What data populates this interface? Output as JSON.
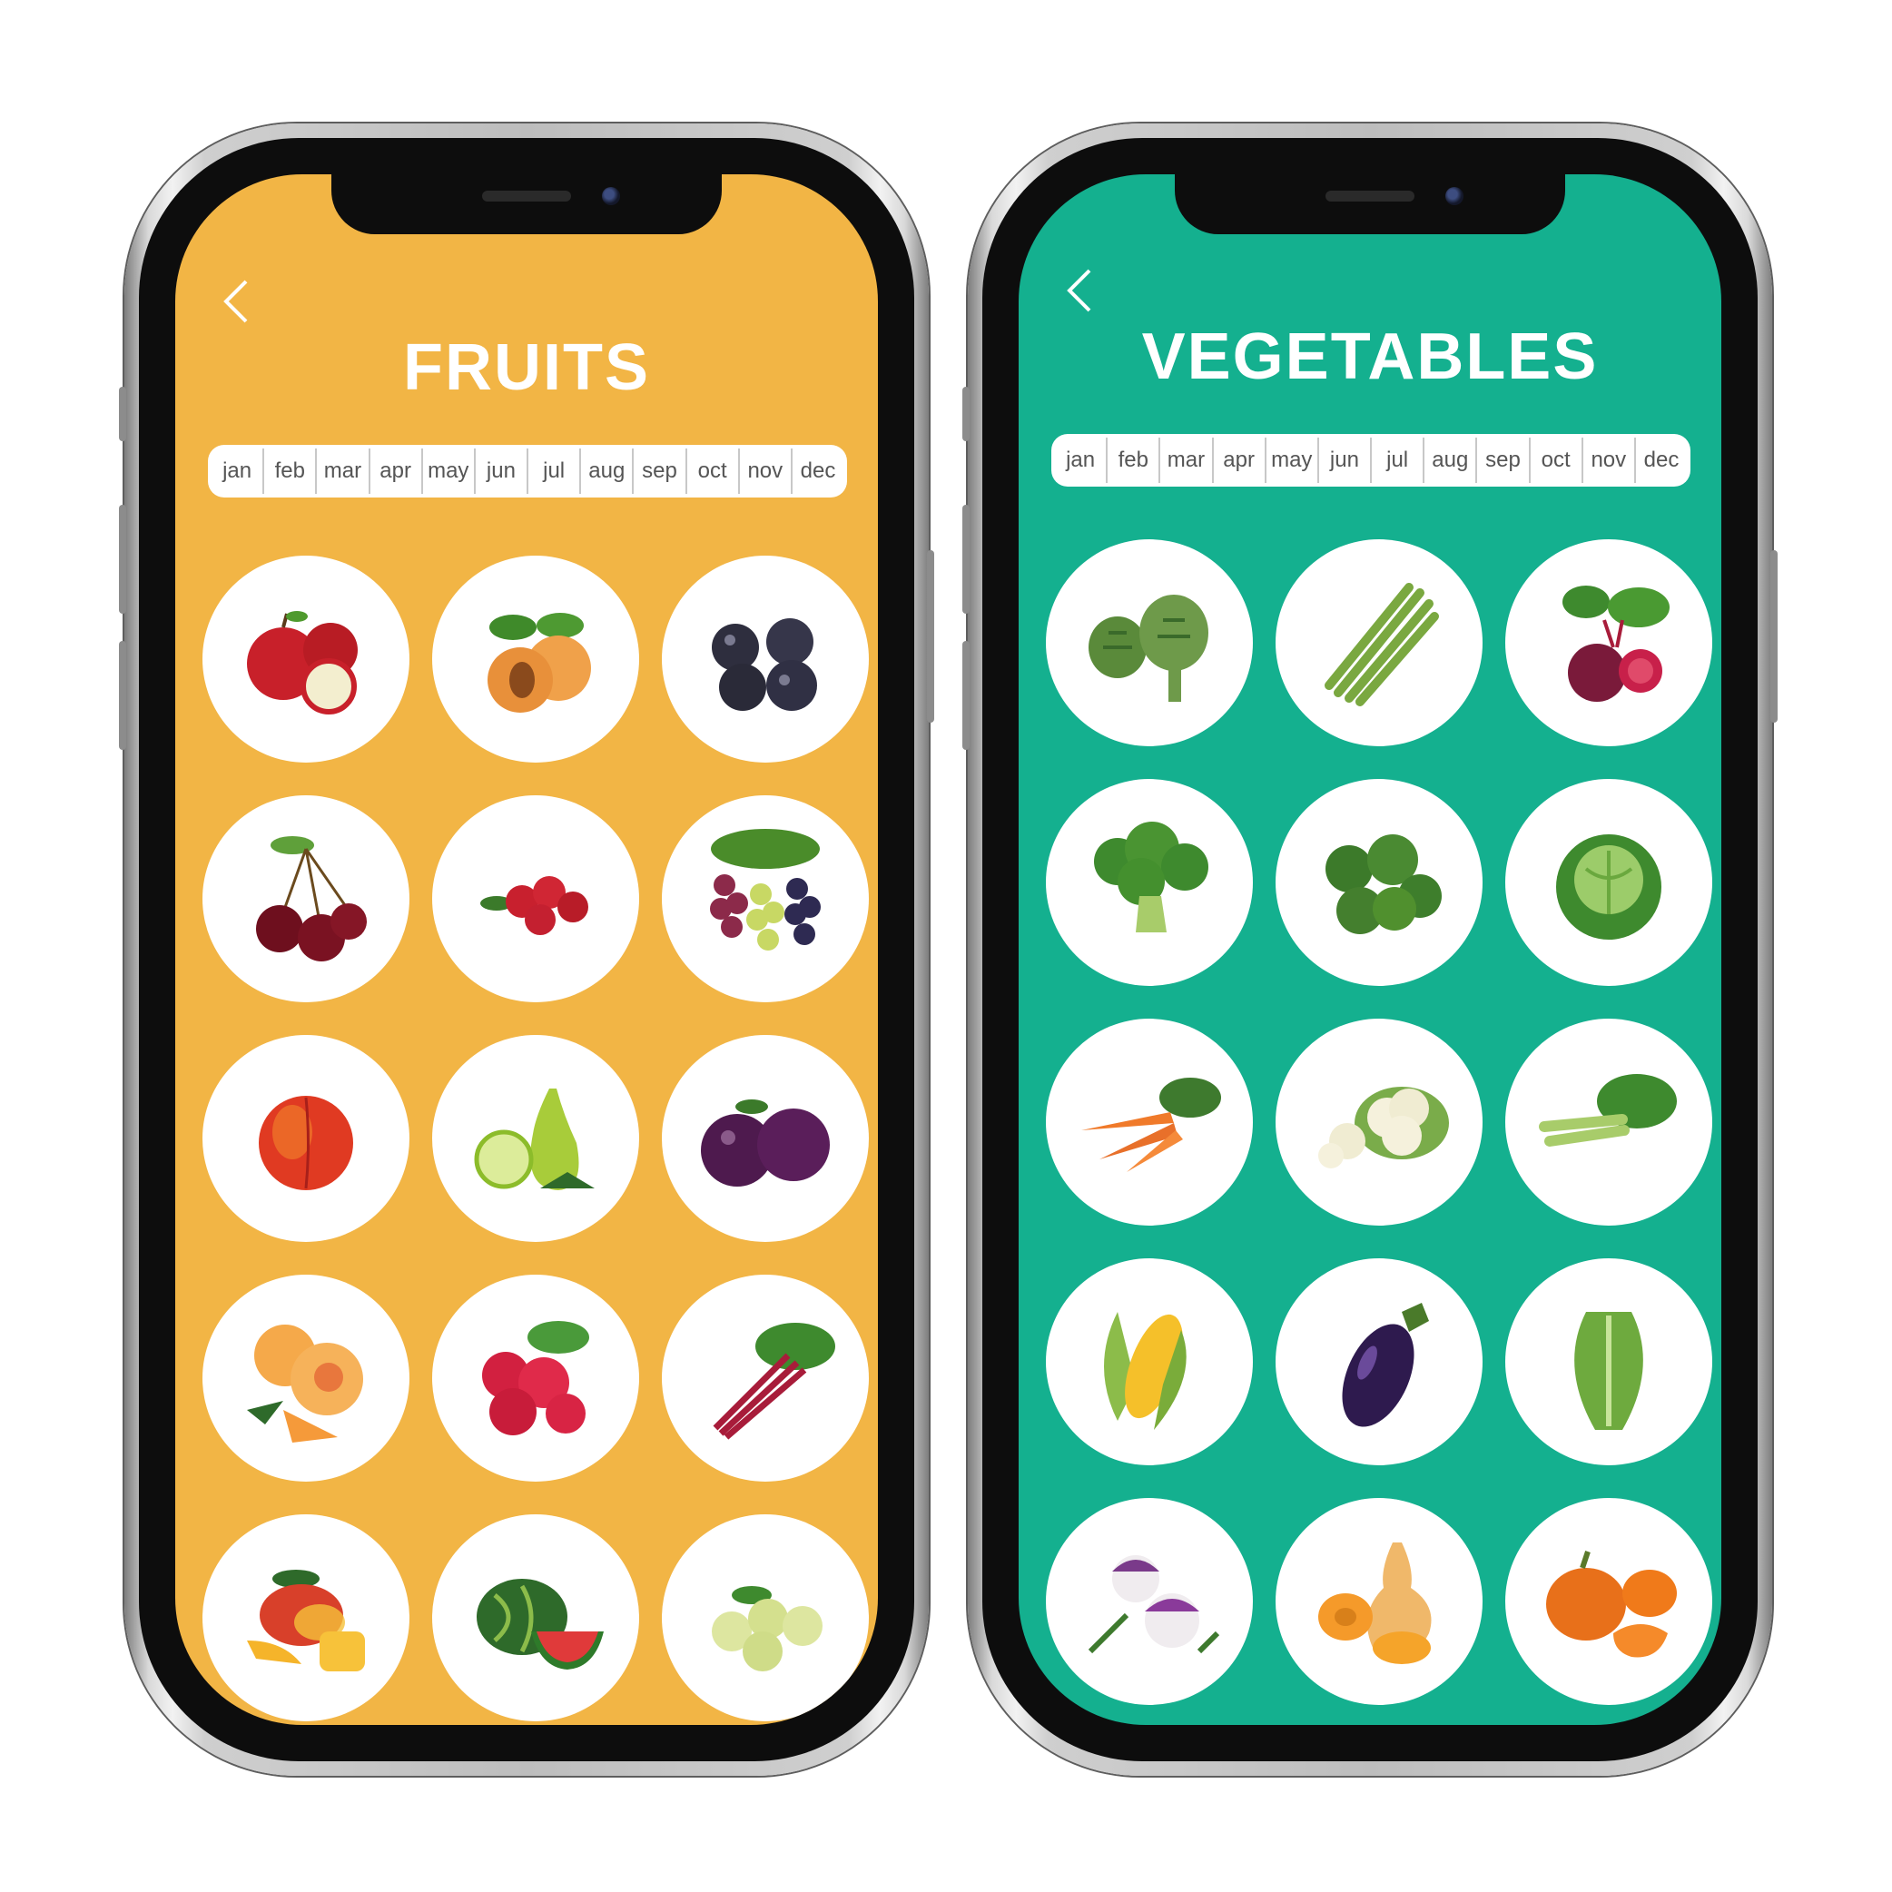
{
  "fruits_screen": {
    "back_icon": "chevron-left-icon",
    "title": "FRUITS",
    "months": [
      "jan",
      "feb",
      "mar",
      "apr",
      "may",
      "jun",
      "jul",
      "aug",
      "sep",
      "oct",
      "nov",
      "dec"
    ],
    "items": [
      "apple",
      "apricot",
      "blackcurrant",
      "cherry",
      "cranberry",
      "grapes",
      "nectarine",
      "pear",
      "plum",
      "peach",
      "raspberry",
      "rhubarb",
      "mango",
      "watermelon",
      "gooseberry"
    ],
    "background_color": "#f2b545"
  },
  "vegetables_screen": {
    "back_icon": "chevron-left-icon",
    "title": "VEGETABLES",
    "months": [
      "jan",
      "feb",
      "mar",
      "apr",
      "may",
      "jun",
      "jul",
      "aug",
      "sep",
      "oct",
      "nov",
      "dec"
    ],
    "items": [
      "artichoke",
      "asparagus",
      "beetroot",
      "broccoli",
      "brussels-sprouts",
      "cabbage",
      "carrot",
      "cauliflower",
      "celery",
      "corn",
      "eggplant",
      "lettuce",
      "turnip",
      "butternut-squash",
      "pumpkin"
    ],
    "background_color": "#14b08f"
  }
}
